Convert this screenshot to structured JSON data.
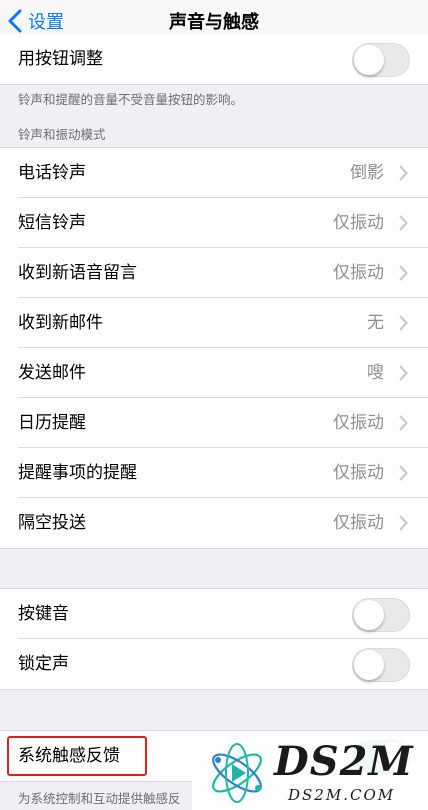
{
  "nav": {
    "back_label": "设置",
    "title": "声音与触感"
  },
  "ringer": {
    "change_with_buttons_label": "用按钮调整",
    "change_with_buttons_on": false,
    "footnote": "铃声和提醒的音量不受音量按钮的影响。"
  },
  "sounds_section": {
    "header": "铃声和振动模式",
    "items": [
      {
        "label": "电话铃声",
        "value": "倒影"
      },
      {
        "label": "短信铃声",
        "value": "仅振动"
      },
      {
        "label": "收到新语音留言",
        "value": "仅振动"
      },
      {
        "label": "收到新邮件",
        "value": "无"
      },
      {
        "label": "发送邮件",
        "value": "嗖"
      },
      {
        "label": "日历提醒",
        "value": "仅振动"
      },
      {
        "label": "提醒事项的提醒",
        "value": "仅振动"
      },
      {
        "label": "隔空投送",
        "value": "仅振动"
      }
    ]
  },
  "clicks": {
    "keyboard_clicks_label": "按键音",
    "keyboard_clicks_on": false,
    "lock_sound_label": "锁定声",
    "lock_sound_on": false
  },
  "haptics": {
    "system_haptics_label": "系统触感反馈",
    "system_haptics_on": true,
    "footnote": "为系统控制和互动提供触感反"
  },
  "watermark": {
    "main": "DS2M",
    "sub": "DS2M.COM"
  },
  "colors": {
    "accent": "#0a7aff",
    "toggle_on": "#34c759",
    "highlight": "#e02020",
    "background": "#efeff4"
  }
}
